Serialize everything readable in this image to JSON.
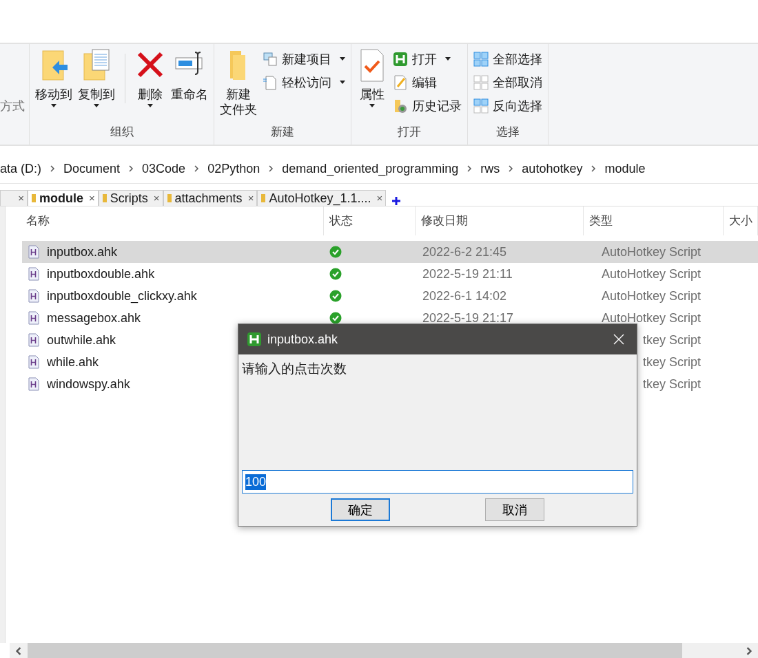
{
  "ribbon": {
    "groups": [
      {
        "items": [
          {
            "kind": "cut",
            "label": "方式",
            "disabled": true
          }
        ]
      },
      {
        "label": "组织",
        "items": [
          {
            "kind": "large",
            "label": "移动到",
            "dropdown": true
          },
          {
            "kind": "large",
            "label": "复制到",
            "dropdown": true
          },
          {
            "kind": "sep"
          },
          {
            "kind": "large",
            "label": "删除",
            "dropdown": true
          },
          {
            "kind": "large",
            "label": "重命名",
            "dropdown": false
          }
        ]
      },
      {
        "label": "新建",
        "items": [
          {
            "kind": "large",
            "lines": [
              "新建",
              "文件夹"
            ],
            "dropdown": false
          },
          {
            "kind": "small",
            "label": "新建项目",
            "dropdown": true
          },
          {
            "kind": "small",
            "label": "轻松访问",
            "dropdown": true
          }
        ]
      },
      {
        "label": "打开",
        "items": [
          {
            "kind": "large",
            "label": "属性",
            "dropdown": true
          },
          {
            "kind": "small",
            "label": "打开",
            "dropdown": true
          },
          {
            "kind": "small",
            "label": "编辑",
            "dropdown": false
          },
          {
            "kind": "small",
            "label": "历史记录",
            "dropdown": false
          }
        ]
      },
      {
        "label": "选择",
        "items": [
          {
            "kind": "small",
            "label": "全部选择",
            "dropdown": false
          },
          {
            "kind": "small",
            "label": "全部取消",
            "dropdown": false
          },
          {
            "kind": "small",
            "label": "反向选择",
            "dropdown": false
          }
        ]
      }
    ]
  },
  "breadcrumb": [
    "ata (D:)",
    "Document",
    "03Code",
    "02Python",
    "demand_oriented_programming",
    "rws",
    "autohotkey",
    "module"
  ],
  "tabs": [
    {
      "close": "×",
      "selected": false
    },
    {
      "label": "module",
      "close": "×",
      "selected": true
    },
    {
      "label": "Scripts",
      "close": "×",
      "selected": false
    },
    {
      "label": "attachments",
      "close": "×",
      "selected": false
    },
    {
      "label": "AutoHotkey_1.1....",
      "close": "×",
      "selected": false
    }
  ],
  "columns": [
    "名称",
    "状态",
    "修改日期",
    "类型",
    "大小"
  ],
  "files": [
    {
      "name": "inputbox.ahk",
      "synced": true,
      "date": "2022-6-2 21:45",
      "type": "AutoHotkey Script",
      "selected": true
    },
    {
      "name": "inputboxdouble.ahk",
      "synced": true,
      "date": "2022-5-19 21:11",
      "type": "AutoHotkey Script",
      "selected": false
    },
    {
      "name": "inputboxdouble_clickxy.ahk",
      "synced": true,
      "date": "2022-6-1 14:02",
      "type": "AutoHotkey Script",
      "selected": false
    },
    {
      "name": "messagebox.ahk",
      "synced": true,
      "date": "2022-5-19 21:17",
      "type": "AutoHotkey Script",
      "selected": false
    },
    {
      "name": "outwhile.ahk",
      "synced": false,
      "type": "tkey Script",
      "selected": false
    },
    {
      "name": "while.ahk",
      "synced": false,
      "type": "tkey Script",
      "selected": false
    },
    {
      "name": "windowspy.ahk",
      "synced": false,
      "type": "tkey Script",
      "selected": false
    }
  ],
  "dialog": {
    "title": "inputbox.ahk",
    "prompt": "请输入的点击次数",
    "value": "100",
    "buttons": [
      {
        "label": "确定",
        "selected": true
      },
      {
        "label": "取消",
        "selected": false
      }
    ]
  }
}
